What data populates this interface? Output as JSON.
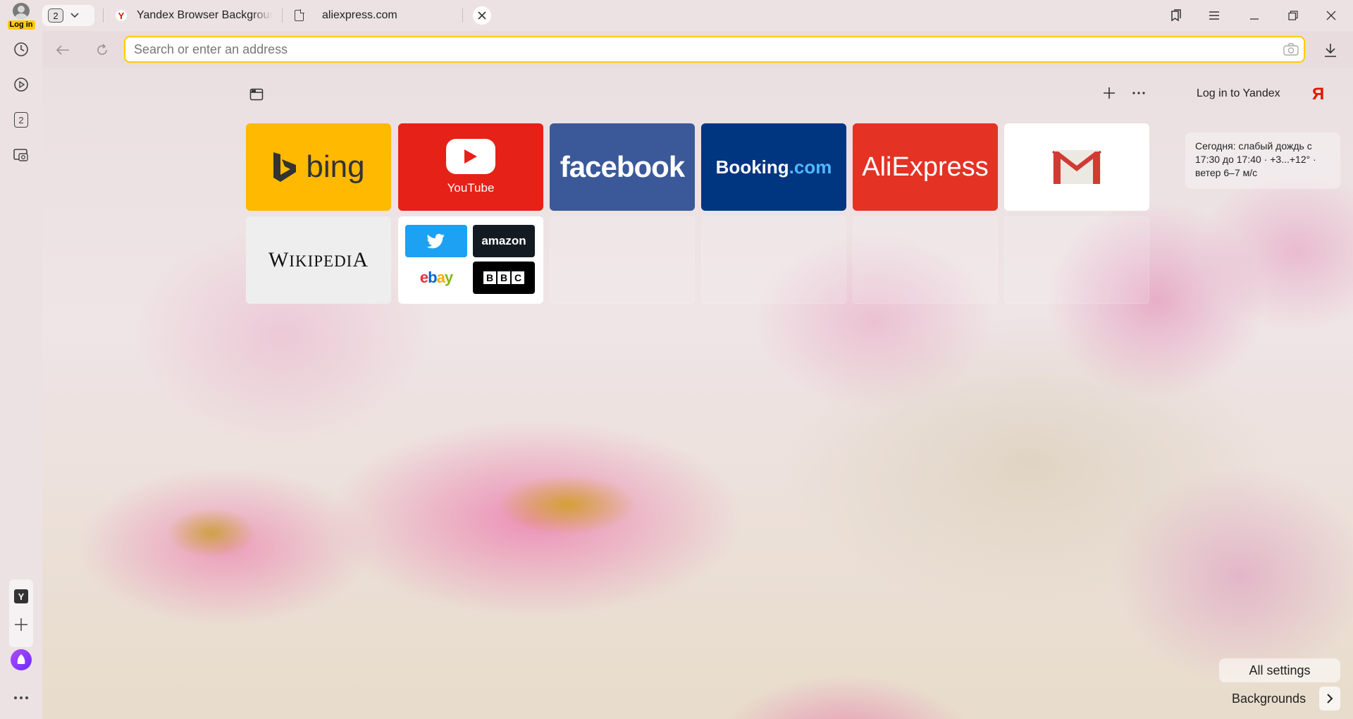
{
  "login": {
    "label": "Log in"
  },
  "tabs": {
    "group_count": "2",
    "items": [
      {
        "title": "Yandex Browser Backgrounds"
      },
      {
        "title": "aliexpress.com"
      }
    ]
  },
  "sidebar": {
    "tabs_count": "2"
  },
  "address_bar": {
    "placeholder": "Search or enter an address",
    "value": ""
  },
  "toolbar": {
    "login_yandex": "Log in to Yandex",
    "yandex_logo": "Я"
  },
  "tiles": {
    "bing": "bing",
    "youtube": "YouTube",
    "facebook": "facebook",
    "booking_main": "Booking",
    "booking_tld": ".com",
    "aliexpress": "AliExpress",
    "wikipedia_w": "W",
    "wikipedia_rest": "IKIPEDI",
    "wikipedia_a": "A",
    "amazon": "amazon",
    "ebay_e": "e",
    "ebay_b": "b",
    "ebay_a": "a",
    "ebay_y": "y",
    "bbc_b1": "B",
    "bbc_b2": "B",
    "bbc_c": "C"
  },
  "weather": {
    "text": "Сегодня: слабый дождь с 17:30 до 17:40 · +3...+12° · ветер 6–7 м/с"
  },
  "footer": {
    "all_settings": "All settings",
    "backgrounds": "Backgrounds"
  },
  "colors": {
    "accent": "#ffcc00",
    "yandex_red": "#e61400",
    "bing": "#ffb900",
    "youtube": "#e62117",
    "facebook": "#3b5998",
    "booking": "#003580",
    "aliexpress": "#e43225",
    "twitter": "#1da1f2",
    "alice": "#8a3cff"
  },
  "icons": [
    "user-icon",
    "history-icon",
    "play-icon",
    "tabs-icon",
    "screenshot-icon",
    "yandex-icon",
    "plus-icon",
    "alice-icon",
    "more-icon",
    "back-icon",
    "reload-icon",
    "camera-icon",
    "download-icon",
    "bookmarks-icon",
    "menu-icon",
    "minimize-icon",
    "restore-icon",
    "close-icon"
  ]
}
